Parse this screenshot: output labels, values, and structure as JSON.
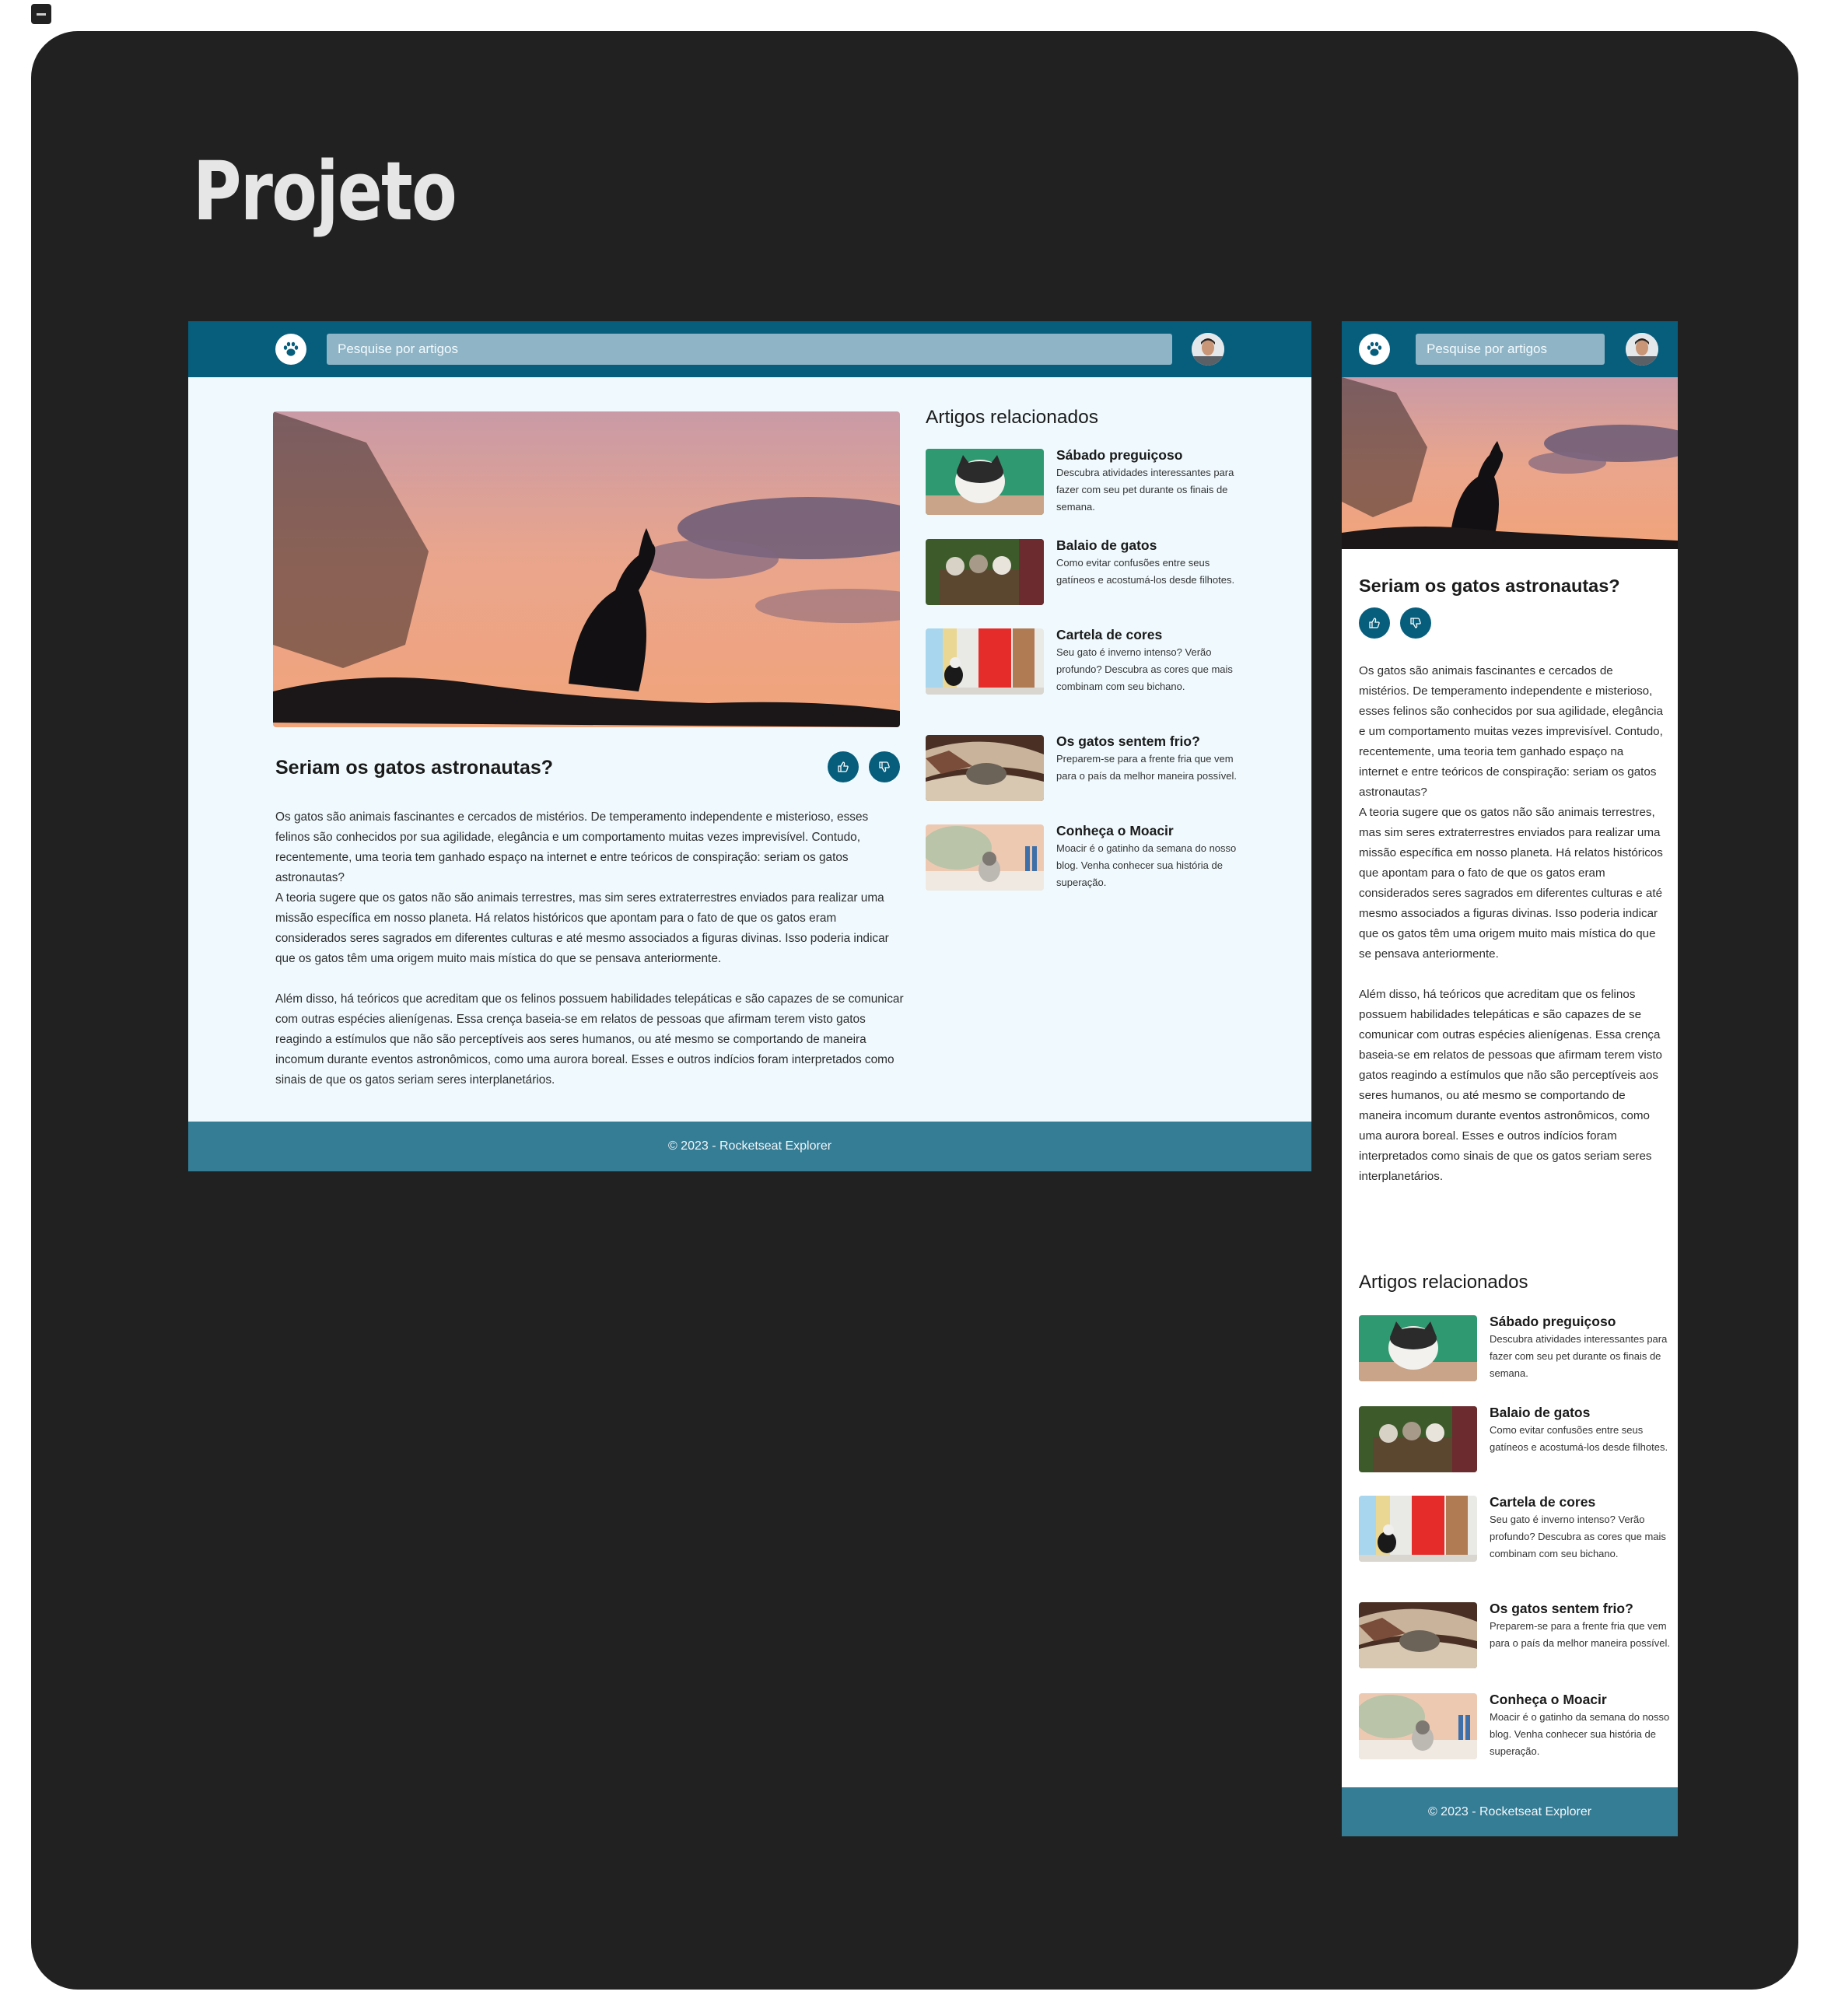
{
  "page": {
    "title": "Projeto"
  },
  "header": {
    "search_placeholder": "Pesquise por artigos",
    "logo_icon": "paw-icon",
    "avatar_icon": "user-avatar"
  },
  "article": {
    "title": "Seriam os gatos astronautas?",
    "like_icon": "thumbs-up-icon",
    "dislike_icon": "thumbs-down-icon",
    "paragraph1": "Os gatos são animais fascinantes e cercados de mistérios. De temperamento independente e misterioso, esses felinos são conhecidos por sua agilidade, elegância e um comportamento muitas vezes imprevisível. Contudo, recentemente, uma teoria tem ganhado espaço na internet e entre teóricos de conspiração: seriam os gatos astronautas?",
    "paragraph2": "A teoria sugere que os gatos não são animais terrestres, mas sim seres extraterrestres enviados para realizar uma missão específica em nosso planeta. Há relatos históricos que apontam para o fato de que os gatos eram considerados seres sagrados em diferentes culturas e até mesmo associados a figuras divinas. Isso poderia indicar que os gatos têm uma origem muito mais mística do que se pensava anteriormente.",
    "paragraph3": "Além disso, há teóricos que acreditam que os felinos possuem habilidades telepáticas e são capazes de se comunicar com outras espécies alienígenas. Essa crença baseia-se em relatos de pessoas que afirmam terem visto gatos reagindo a estímulos que não são perceptíveis aos seres humanos, ou até mesmo se comportando de maneira incomum durante eventos astronômicos, como uma aurora boreal. Esses e outros indícios foram interpretados como sinais de que os gatos seriam seres interplanetários."
  },
  "related": {
    "title": "Artigos relacionados",
    "items": [
      {
        "name": "Sábado preguiçoso",
        "desc": "Descubra atividades interessantes para fazer com seu pet durante os finais de semana."
      },
      {
        "name": "Balaio de gatos",
        "desc": "Como evitar confusões entre seus gatíneos e acostumá-los desde filhotes."
      },
      {
        "name": "Cartela de cores",
        "desc": "Seu gato é inverno intenso? Verão profundo? Descubra as cores que mais combinam com seu bichano."
      },
      {
        "name": "Os gatos sentem frio?",
        "desc": "Preparem-se para a frente fria que vem para o país da melhor maneira possível."
      },
      {
        "name": "Conheça o Moacir",
        "desc": "Moacir é o gatinho da semana do nosso blog. Venha conhecer sua história de superação."
      }
    ]
  },
  "footer": {
    "text": "© 2023 - Rocketseat Explorer"
  },
  "colors": {
    "header": "#065e7c",
    "footer": "#357c95",
    "stage": "#212121",
    "search": "#8eb4c5"
  }
}
